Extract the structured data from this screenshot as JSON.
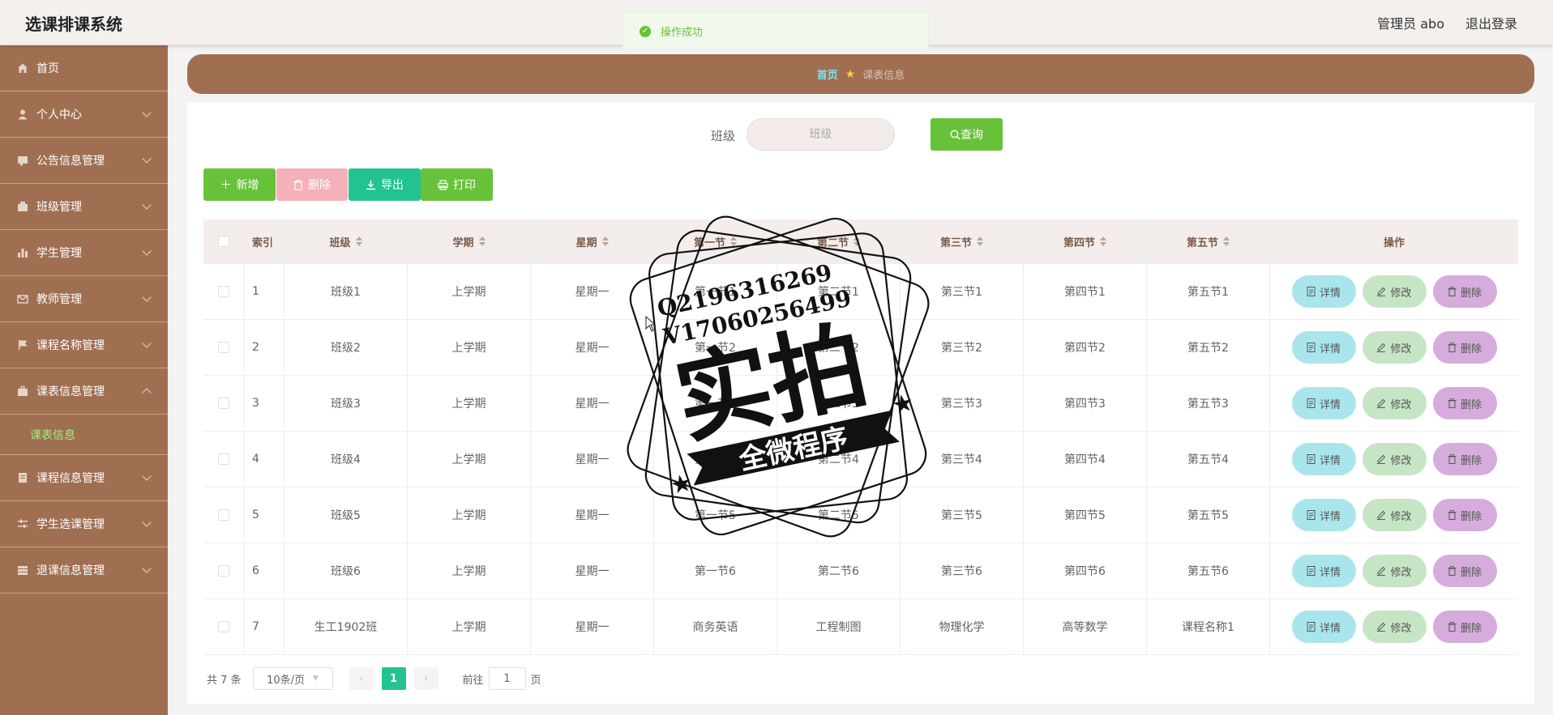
{
  "header": {
    "app_title": "选课排课系统",
    "user_label": "管理员 abo",
    "logout_label": "退出登录"
  },
  "toast": {
    "message": "操作成功"
  },
  "sidebar": {
    "items": [
      {
        "label": "首页",
        "icon": "home-icon"
      },
      {
        "label": "个人中心",
        "icon": "user-icon"
      },
      {
        "label": "公告信息管理",
        "icon": "notice-icon"
      },
      {
        "label": "班级管理",
        "icon": "class-icon"
      },
      {
        "label": "学生管理",
        "icon": "chart-icon"
      },
      {
        "label": "教师管理",
        "icon": "mail-icon"
      },
      {
        "label": "课程名称管理",
        "icon": "flag-icon"
      },
      {
        "label": "课表信息管理",
        "icon": "briefcase-icon",
        "expanded": true,
        "children": [
          {
            "label": "课表信息"
          }
        ]
      },
      {
        "label": "课程信息管理",
        "icon": "document-icon"
      },
      {
        "label": "学生选课管理",
        "icon": "sliders-icon"
      },
      {
        "label": "退课信息管理",
        "icon": "stack-icon"
      }
    ]
  },
  "breadcrumb": {
    "home": "首页",
    "current": "课表信息"
  },
  "search": {
    "label": "班级",
    "placeholder": "班级",
    "button_label": "查询"
  },
  "toolbar": {
    "add_label": "新增",
    "delete_label": "删除",
    "export_label": "导出",
    "print_label": "打印"
  },
  "table": {
    "columns": [
      "索引",
      "班级",
      "学期",
      "星期",
      "第一节",
      "第二节",
      "第三节",
      "第四节",
      "第五节",
      "操作"
    ],
    "rows": [
      [
        "1",
        "班级1",
        "上学期",
        "星期一",
        "第一节1",
        "第二节1",
        "第三节1",
        "第四节1",
        "第五节1"
      ],
      [
        "2",
        "班级2",
        "上学期",
        "星期一",
        "第一节2",
        "第二节2",
        "第三节2",
        "第四节2",
        "第五节2"
      ],
      [
        "3",
        "班级3",
        "上学期",
        "星期一",
        "第一节3",
        "第二节3",
        "第三节3",
        "第四节3",
        "第五节3"
      ],
      [
        "4",
        "班级4",
        "上学期",
        "星期一",
        "第一节4",
        "第二节4",
        "第三节4",
        "第四节4",
        "第五节4"
      ],
      [
        "5",
        "班级5",
        "上学期",
        "星期一",
        "第一节5",
        "第二节5",
        "第三节5",
        "第四节5",
        "第五节5"
      ],
      [
        "6",
        "班级6",
        "上学期",
        "星期一",
        "第一节6",
        "第二节6",
        "第三节6",
        "第四节6",
        "第五节6"
      ],
      [
        "7",
        "生工1902班",
        "上学期",
        "星期一",
        "商务英语",
        "工程制图",
        "物理化学",
        "高等数学",
        "课程名称1"
      ]
    ],
    "row_actions": {
      "detail": "详情",
      "edit": "修改",
      "delete": "删除"
    }
  },
  "pagination": {
    "total_label": "共 7 条",
    "page_size_label": "10条/页",
    "current_page": "1",
    "goto_prefix": "前往",
    "goto_value": "1",
    "goto_suffix": "页"
  },
  "watermark": {
    "line1": "Q2196316269",
    "line2": "V17060256499",
    "main": "实拍",
    "banner": "全微程序"
  },
  "colors": {
    "sidebar_bg": "#a06f52",
    "accent_green": "#67c23a",
    "teal": "#22c391",
    "detail_btn": "#a9e6ec",
    "edit_btn": "#c6e5c4",
    "delete_btn": "#d5acdc"
  }
}
